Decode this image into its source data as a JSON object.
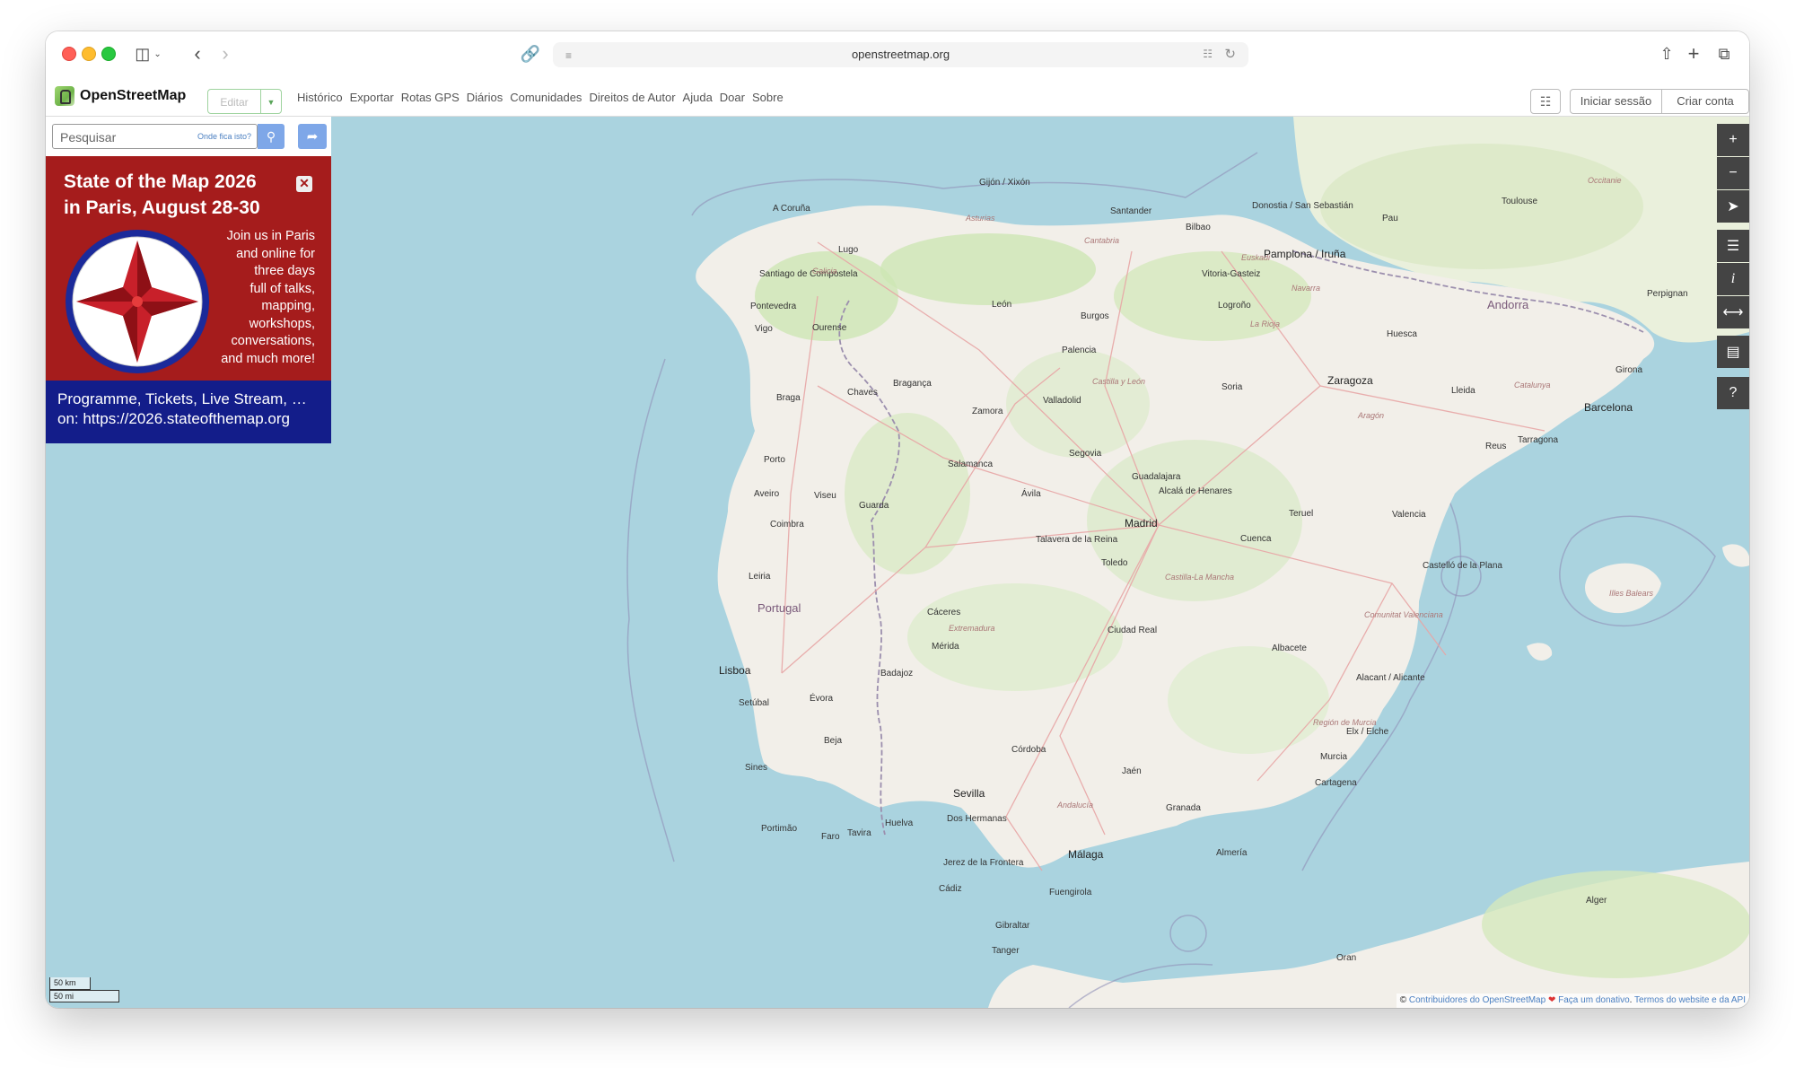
{
  "browser": {
    "url": "openstreetmap.org"
  },
  "header": {
    "logo_text": "OpenStreetMap",
    "edit_label": "Editar",
    "nav": [
      "Histórico",
      "Exportar",
      "Rotas GPS",
      "Diários",
      "Comunidades",
      "Direitos de Autor",
      "Ajuda",
      "Doar",
      "Sobre"
    ],
    "login_label": "Iniciar sessão",
    "signup_label": "Criar conta"
  },
  "search": {
    "placeholder": "Pesquisar",
    "where_is": "Onde fica isto?"
  },
  "banner": {
    "title_line1": "State of the Map 2026",
    "title_line2": "in Paris, August 28-30",
    "text_lines": [
      "Join us in Paris",
      "and online for",
      "three days",
      "full of talks,",
      "mapping,",
      "workshops,",
      "conversations,",
      "and much more!"
    ],
    "link_line1": "Programme, Tickets, Live Stream, …",
    "link_line2": "on: https://2026.stateofthemap.org"
  },
  "map": {
    "countries": [
      "Portugal",
      "Andorra"
    ],
    "cities_major": [
      "Madrid",
      "Barcelona",
      "Sevilla",
      "Zaragoza",
      "Lisboa",
      "Pamplona / Iruña",
      "Málaga",
      "Porto"
    ],
    "cities": [
      "A Coruña",
      "Gijón / Xixón",
      "Santander",
      "Bilbao",
      "Donostia / San Sebastián",
      "Toulouse",
      "Pau",
      "Perpignan",
      "Lugo",
      "Santiago de Compostela",
      "Pontevedra",
      "Vigo",
      "Ourense",
      "León",
      "Burgos",
      "Vitoria-Gasteiz",
      "Logroño",
      "Huesca",
      "Girona",
      "Palencia",
      "Valladolid",
      "Braga",
      "Bragança",
      "Chaves",
      "Soria",
      "Lleida",
      "Tarragona",
      "Reus",
      "Zamora",
      "Salamanca",
      "Segovia",
      "Ávila",
      "Aveiro",
      "Viseu",
      "Guarda",
      "Coimbra",
      "Teruel",
      "Cuenca",
      "Toledo",
      "Castelló de la Plana",
      "Leiria",
      "Cáceres",
      "Badajoz",
      "Mérida",
      "Ciudad Real",
      "Albacete",
      "Valencia",
      "Évora",
      "Beja",
      "Córdoba",
      "Jaén",
      "Murcia",
      "Alacant / Alicante",
      "Cartagena",
      "Granada",
      "Almería",
      "Huelva",
      "Faro",
      "Cádiz",
      "Gibraltar",
      "Tanger",
      "Oran",
      "Alger",
      "Setúbal",
      "Sines",
      "Portimão",
      "Tavira",
      "Jerez de la Frontera",
      "Fuengirola",
      "Dos Hermanas",
      "Elx / Elche",
      "Talavera de la Reina",
      "Guadalajara",
      "Alcalá de Henares"
    ],
    "regions": [
      "Asturias",
      "Cantabria",
      "Galicia",
      "Euskadi",
      "Navarra",
      "La Rioja",
      "Castilla y León",
      "Aragón",
      "Catalunya",
      "Castilla-La Mancha",
      "Extremadura",
      "Comunitat Valenciana",
      "Región de Murcia",
      "Andalucía",
      "Illes Balears",
      "Occitanie"
    ],
    "scale_km": "50 km",
    "scale_mi": "50 mi",
    "attribution_prefix": "© ",
    "attribution_contrib": "Contribuidores do OpenStreetMap",
    "attribution_donate": "Faça um donativo",
    "attribution_terms": "Termos do website e da API"
  },
  "colors": {
    "sea": "#aad3df",
    "land": "#f2efe9",
    "banner_red": "#a51c1c",
    "banner_blue": "#131d8a",
    "accent": "#7ea7e8"
  }
}
